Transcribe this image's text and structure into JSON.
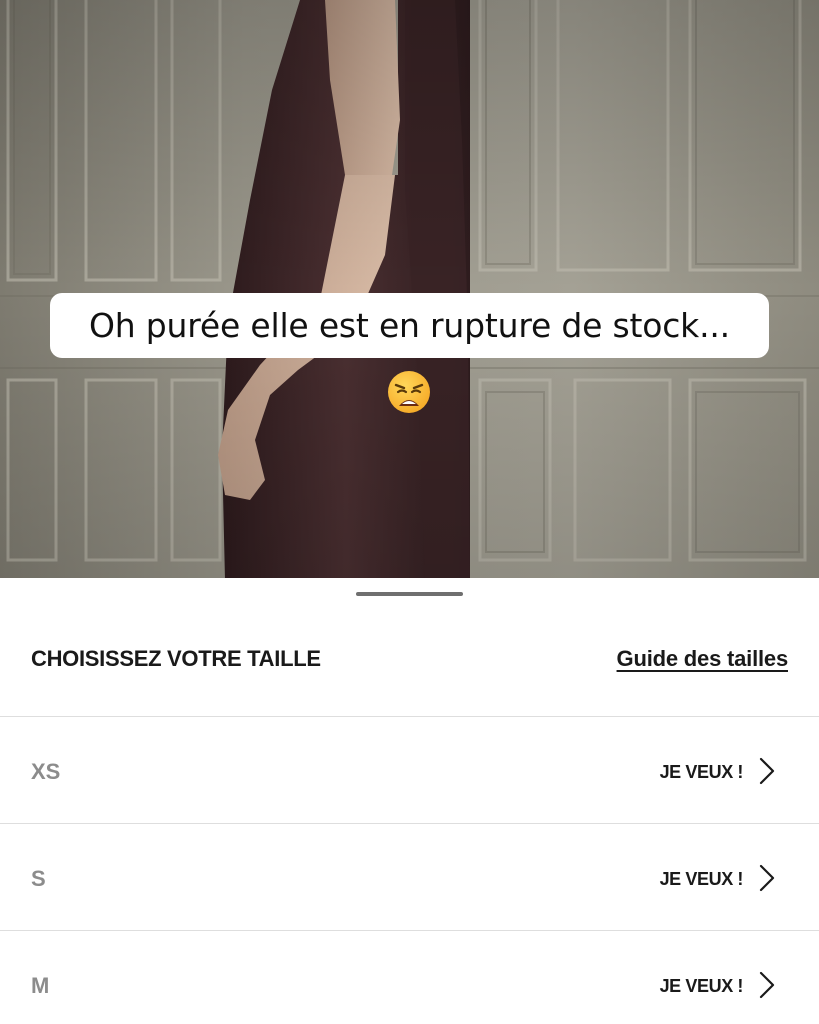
{
  "story": {
    "caption": "Oh purée elle est en rupture de stock...",
    "emoji": "weary-face-emoji"
  },
  "sheet": {
    "title": "CHOISISSEZ VOTRE TAILLE",
    "size_guide_label": "Guide des tailles",
    "sizes": [
      {
        "label": "XS",
        "action": "JE VEUX !"
      },
      {
        "label": "S",
        "action": "JE VEUX !"
      },
      {
        "label": "M",
        "action": "JE VEUX !"
      }
    ]
  },
  "icons": {
    "row_chevron": "chevron-right-icon",
    "handle": "drag-handle"
  },
  "colors": {
    "dress": "#3b2527",
    "wall": "#8f8c80",
    "muted_size_text": "#8c8c8c",
    "divider": "#dedede"
  }
}
